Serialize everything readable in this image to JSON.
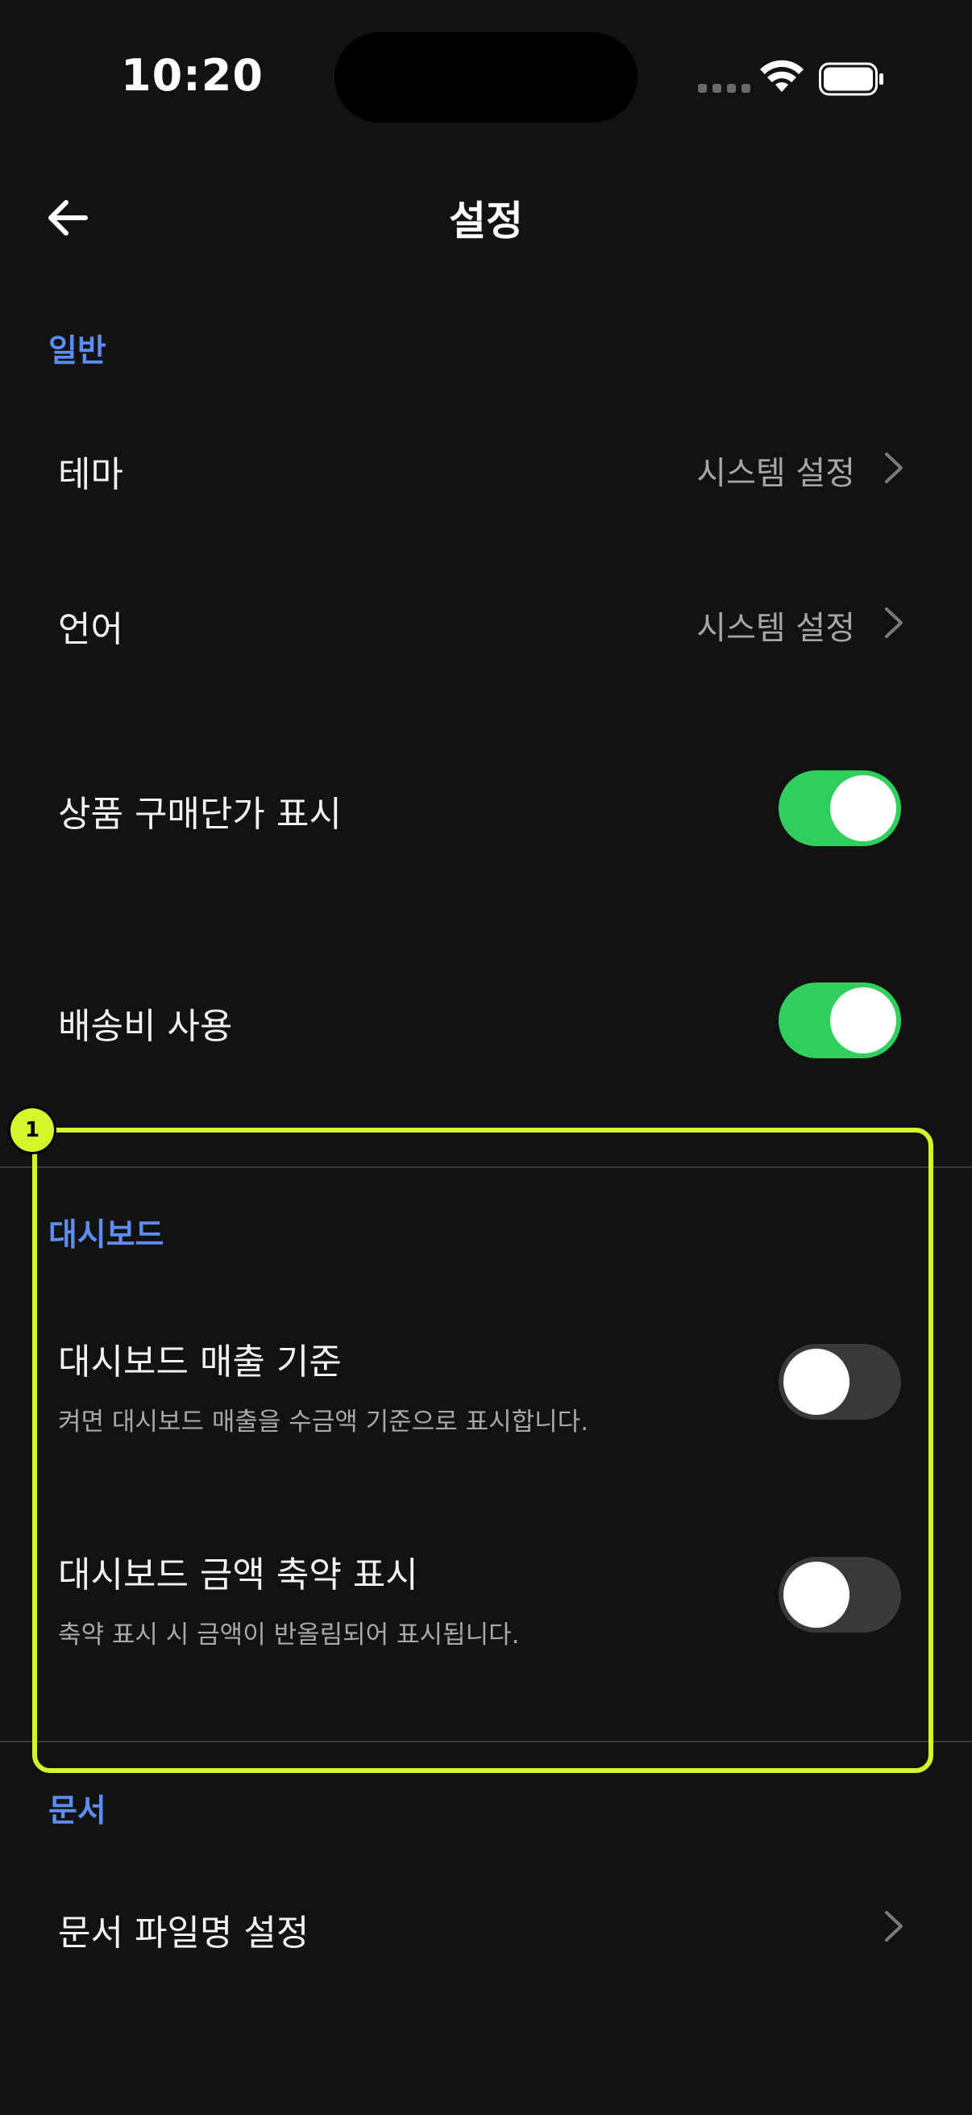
{
  "status_bar": {
    "time": "10:20"
  },
  "header": {
    "title": "설정",
    "back_icon": "arrow-left-icon"
  },
  "sections": {
    "general": {
      "label": "일반",
      "theme": {
        "label": "테마",
        "value": "시스템 설정"
      },
      "language": {
        "label": "언어",
        "value": "시스템 설정"
      },
      "show_purchase_price": {
        "label": "상품 구매단가 표시",
        "enabled": true
      },
      "use_shipping_fee": {
        "label": "배송비 사용",
        "enabled": true
      }
    },
    "dashboard": {
      "label": "대시보드",
      "sales_basis": {
        "label": "대시보드 매출 기준",
        "description": "켜면 대시보드 매출을 수금액 기준으로 표시합니다.",
        "enabled": false
      },
      "abbreviate_amount": {
        "label": "대시보드 금액 축약 표시",
        "description": "축약 표시 시 금액이 반올림되어 표시됩니다.",
        "enabled": false
      }
    },
    "documents": {
      "label": "문서",
      "filename_setting": {
        "label": "문서 파일명 설정"
      }
    }
  },
  "annotation": {
    "badge": "1"
  },
  "colors": {
    "accent": "#5b8ef0",
    "toggle_on": "#2fcf5d",
    "toggle_off": "#3a3a3c",
    "highlight": "#d6f52a",
    "background": "#121212"
  }
}
